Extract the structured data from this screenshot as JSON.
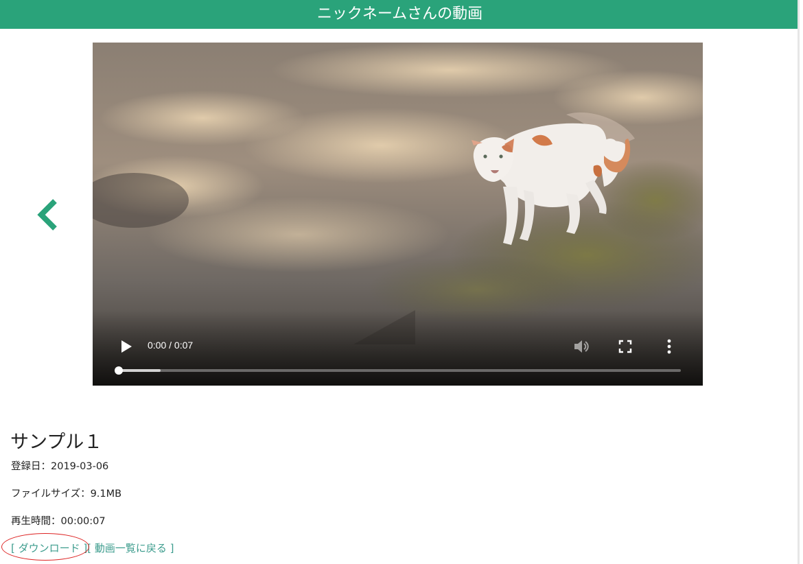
{
  "header": {
    "title": "ニックネームさんの動画"
  },
  "video": {
    "time_display": "0:00 / 0:07",
    "progress": 0.0,
    "buffered": 0.075
  },
  "info": {
    "title": "サンプル１",
    "registered": "登録日：2019-03-06",
    "file_size": "ファイルサイズ：9.1MB",
    "duration": "再生時間：00:00:07"
  },
  "links": {
    "download": "[ ダウンロード ]",
    "back_to_list": "[ 動画一覧に戻る ]"
  },
  "colors": {
    "accent": "#2aa37a",
    "annotation": "#dd2222"
  },
  "icons": [
    "chevron-left-icon",
    "play-icon",
    "volume-icon",
    "fullscreen-icon",
    "more-vert-icon"
  ]
}
